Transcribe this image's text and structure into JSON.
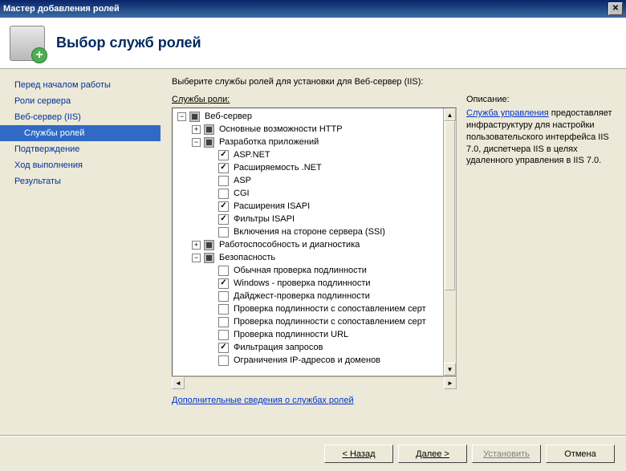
{
  "window": {
    "title": "Мастер добавления ролей"
  },
  "header": {
    "title": "Выбор служб ролей"
  },
  "sidebar": {
    "items": [
      {
        "label": "Перед началом работы"
      },
      {
        "label": "Роли сервера"
      },
      {
        "label": "Веб-сервер (IIS)"
      },
      {
        "label": "Службы ролей"
      },
      {
        "label": "Подтверждение"
      },
      {
        "label": "Ход выполнения"
      },
      {
        "label": "Результаты"
      }
    ]
  },
  "main": {
    "intro": "Выберите службы ролей для установки для Веб-сервер (IIS):",
    "tree_label": "Службы роли:",
    "desc_label": "Описание:",
    "desc_link": "Служба управления",
    "desc_text": " предоставляет инфраструктуру для настройки пользовательского интерфейса IIS 7.0, диспетчера IIS в целях удаленного управления в IIS 7.0.",
    "more_link": "Дополнительные сведения о службах ролей"
  },
  "tree": [
    {
      "depth": 0,
      "twisty": "-",
      "state": "intermediate",
      "label": "Веб-сервер"
    },
    {
      "depth": 1,
      "twisty": "+",
      "state": "intermediate",
      "label": "Основные возможности HTTP"
    },
    {
      "depth": 1,
      "twisty": "-",
      "state": "intermediate",
      "label": "Разработка приложений"
    },
    {
      "depth": 2,
      "twisty": "",
      "state": "checked",
      "label": "ASP.NET"
    },
    {
      "depth": 2,
      "twisty": "",
      "state": "checked",
      "label": "Расширяемость .NET"
    },
    {
      "depth": 2,
      "twisty": "",
      "state": "unchecked",
      "label": "ASP"
    },
    {
      "depth": 2,
      "twisty": "",
      "state": "unchecked",
      "label": "CGI"
    },
    {
      "depth": 2,
      "twisty": "",
      "state": "checked",
      "label": "Расширения ISAPI"
    },
    {
      "depth": 2,
      "twisty": "",
      "state": "checked",
      "label": "Фильтры ISAPI"
    },
    {
      "depth": 2,
      "twisty": "",
      "state": "unchecked",
      "label": "Включения на стороне сервера (SSI)"
    },
    {
      "depth": 1,
      "twisty": "+",
      "state": "intermediate",
      "label": "Работоспособность и диагностика"
    },
    {
      "depth": 1,
      "twisty": "-",
      "state": "intermediate",
      "label": "Безопасность"
    },
    {
      "depth": 2,
      "twisty": "",
      "state": "unchecked",
      "label": "Обычная проверка подлинности"
    },
    {
      "depth": 2,
      "twisty": "",
      "state": "checked",
      "label": "Windows - проверка подлинности"
    },
    {
      "depth": 2,
      "twisty": "",
      "state": "unchecked",
      "label": "Дайджест-проверка подлинности"
    },
    {
      "depth": 2,
      "twisty": "",
      "state": "unchecked",
      "label": "Проверка подлинности с сопоставлением серт"
    },
    {
      "depth": 2,
      "twisty": "",
      "state": "unchecked",
      "label": "Проверка подлинности с сопоставлением серт"
    },
    {
      "depth": 2,
      "twisty": "",
      "state": "unchecked",
      "label": "Проверка подлинности URL"
    },
    {
      "depth": 2,
      "twisty": "",
      "state": "checked",
      "label": "Фильтрация запросов"
    },
    {
      "depth": 2,
      "twisty": "",
      "state": "unchecked",
      "label": "Ограничения IP-адресов и доменов"
    }
  ],
  "footer": {
    "back": "< Назад",
    "next": "Далее >",
    "install": "Установить",
    "cancel": "Отмена"
  }
}
